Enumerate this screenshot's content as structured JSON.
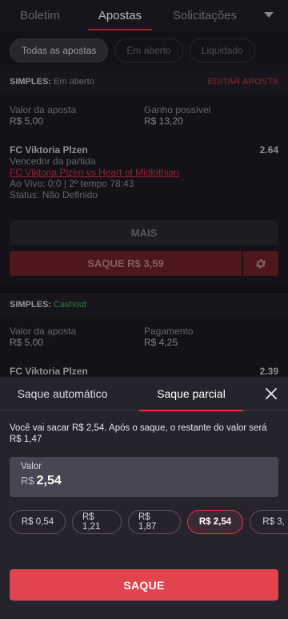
{
  "tabs": [
    {
      "label": "Boletim"
    },
    {
      "label": "Apostas"
    },
    {
      "label": "Solicitações"
    }
  ],
  "filters": [
    {
      "label": "Todas as apostas"
    },
    {
      "label": "Em aberto"
    },
    {
      "label": "Liquidado"
    }
  ],
  "bet1": {
    "kind": "SIMPLES:",
    "status": "Em aberto",
    "edit_label": "EDITAR APOSTA",
    "stake_label": "Valor da aposta",
    "stake_value": "R$ 5,00",
    "win_label": "Ganho possível",
    "win_value": "R$ 13,20",
    "team": "FC Viktoria Plzen",
    "odds": "2.64",
    "market": "Vencedor da partida",
    "match_link": "FC Viktoria Plzen vs Heart of Midlothian",
    "live": "Ao Vivo: 0:0 | 2º tempo 78:43",
    "status_label": "Status:",
    "status_value": "Não Definido",
    "more_label": "MAIS",
    "cashout_label": "SAQUE R$ 3,59"
  },
  "bet2": {
    "kind": "SIMPLES:",
    "status": "Cashout",
    "stake_label": "Valor da aposta",
    "stake_value": "R$ 5,00",
    "pay_label": "Pagamento",
    "pay_value": "R$ 4,25",
    "team": "FC Viktoria Plzen",
    "odds": "2.39"
  },
  "sheet": {
    "tabs": [
      {
        "label": "Saque automático"
      },
      {
        "label": "Saque parcial"
      }
    ],
    "message": "Você vai sacar R$ 2,54. Após o saque, o restante do valor será R$ 1,47",
    "value_label": "Valor",
    "currency": "R$",
    "value": "2,54",
    "amounts": [
      "R$ 0,54",
      "R$ 1,21",
      "R$ 1,87",
      "R$ 2,54",
      "R$ 3,"
    ],
    "submit_label": "SAQUE"
  },
  "colors": {
    "accent": "#e0343d",
    "cashout_green": "#3fae4e",
    "background": "#1c1922"
  },
  "icons": [
    "chevron-down-icon",
    "gear-icon",
    "close-icon"
  ]
}
